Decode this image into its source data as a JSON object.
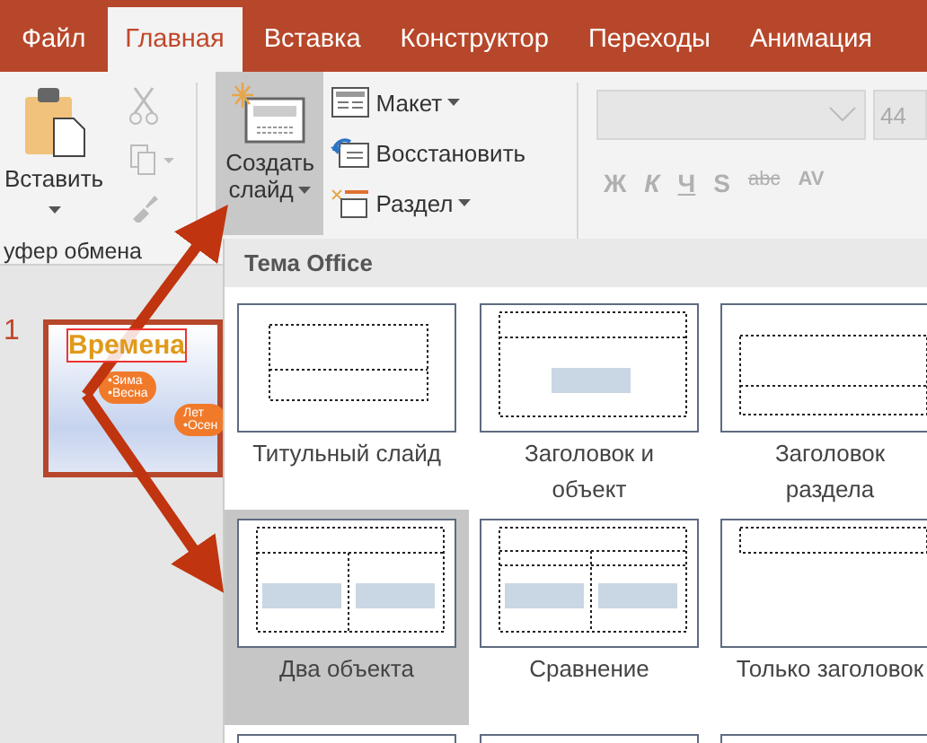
{
  "tabs": [
    {
      "label": "Файл",
      "selected": false
    },
    {
      "label": "Главная",
      "selected": true
    },
    {
      "label": "Вставка",
      "selected": false
    },
    {
      "label": "Конструктор",
      "selected": false
    },
    {
      "label": "Переходы",
      "selected": false
    },
    {
      "label": "Анимация",
      "selected": false
    }
  ],
  "clipboard": {
    "paste_label": "Вставить",
    "group_label": "уфер обмена",
    "disabled": true
  },
  "slides_group": {
    "new_slide": [
      "Создать",
      "слайд"
    ],
    "new_slide_selected": true,
    "items": [
      {
        "label": "Макет",
        "kind": "layout",
        "has_menu": true
      },
      {
        "label": "Восстановить",
        "kind": "reset",
        "has_menu": false
      },
      {
        "label": "Раздел",
        "kind": "section",
        "has_menu": true
      }
    ]
  },
  "font": {
    "disabled": true,
    "size": "44",
    "format_buttons": [
      "Ж",
      "К",
      "Ч",
      "S",
      "abc",
      "AV"
    ]
  },
  "slide_pane": {
    "number": "1",
    "slide": {
      "title": "Времена",
      "bullets": [
        "•Зима",
        "•Весна"
      ],
      "bullets_2": [
        "Лет",
        "•Осен"
      ]
    }
  },
  "layout_gallery": {
    "heading": "Тема Office",
    "layouts": [
      {
        "label": "Титульный слайд",
        "kind": "title",
        "selected": false
      },
      {
        "label": "Заголовок и объект",
        "kind": "title-content",
        "selected": false
      },
      {
        "label": "Заголовок раздела",
        "kind": "section",
        "selected": false
      },
      {
        "label": "Два объекта",
        "kind": "two-content",
        "selected": true
      },
      {
        "label": "Сравнение",
        "kind": "comparison",
        "selected": false
      },
      {
        "label": "Только заголовок",
        "kind": "title-only",
        "selected": false
      }
    ]
  }
}
